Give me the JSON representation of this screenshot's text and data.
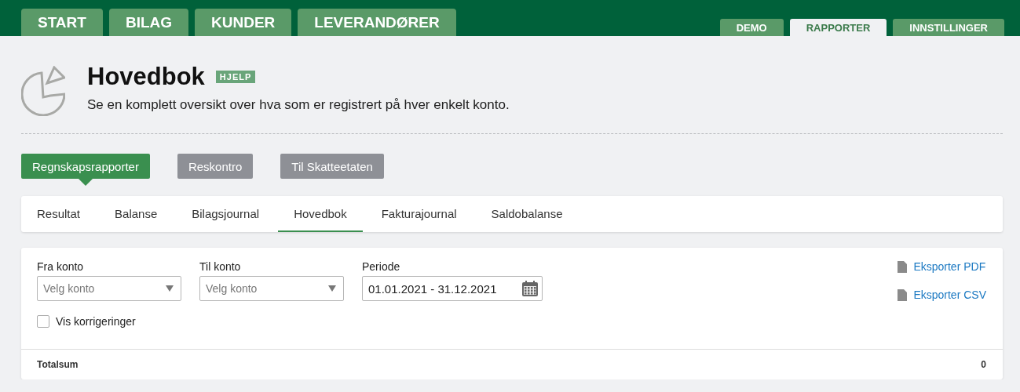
{
  "main_nav": [
    {
      "label": "START",
      "selected": false
    },
    {
      "label": "BILAG",
      "selected": false
    },
    {
      "label": "KUNDER",
      "selected": false
    },
    {
      "label": "LEVERANDØRER",
      "selected": false
    }
  ],
  "secondary_nav": [
    {
      "label": "DEMO",
      "selected": false
    },
    {
      "label": "RAPPORTER",
      "selected": true
    },
    {
      "label": "INNSTILLINGER",
      "selected": false
    }
  ],
  "header": {
    "title": "Hovedbok",
    "help_badge": "HJELP",
    "description": "Se en komplett oversikt over hva som er registrert på hver enkelt konto."
  },
  "report_groups": [
    {
      "label": "Regnskapsrapporter",
      "selected": true
    },
    {
      "label": "Reskontro",
      "selected": false
    },
    {
      "label": "Til Skatteetaten",
      "selected": false
    }
  ],
  "report_tabs": [
    {
      "label": "Resultat",
      "selected": false
    },
    {
      "label": "Balanse",
      "selected": false
    },
    {
      "label": "Bilagsjournal",
      "selected": false
    },
    {
      "label": "Hovedbok",
      "selected": true
    },
    {
      "label": "Fakturajournal",
      "selected": false
    },
    {
      "label": "Saldobalanse",
      "selected": false
    }
  ],
  "filters": {
    "fields": [
      {
        "kind": "select",
        "label": "Fra konto",
        "placeholder": "Velg konto"
      },
      {
        "kind": "select",
        "label": "Til konto",
        "placeholder": "Velg konto"
      },
      {
        "kind": "date",
        "label": "Periode",
        "value": "01.01.2021 - 31.12.2021"
      }
    ],
    "checkbox": {
      "label": "Vis korrigeringer",
      "checked": false
    }
  },
  "exports": [
    {
      "label": "Eksporter PDF"
    },
    {
      "label": "Eksporter CSV"
    }
  ],
  "total": {
    "label": "Totalsum",
    "value": "0"
  }
}
